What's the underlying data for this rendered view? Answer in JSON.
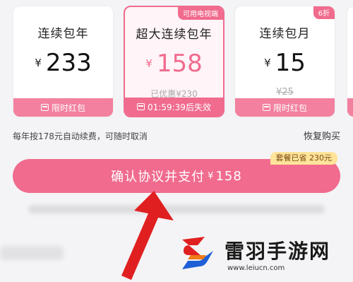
{
  "plans": [
    {
      "name": "连续包年",
      "currency": "¥",
      "price": "233",
      "note": "",
      "footer": "限时红包",
      "tag": ""
    },
    {
      "name": "超大连续包年",
      "currency": "¥",
      "price": "158",
      "note": "已优惠¥230",
      "footer": "01:59:39后失效",
      "tag": "可用电视端",
      "selected": true
    },
    {
      "name": "连续包月",
      "currency": "¥",
      "price": "15",
      "note": "¥25",
      "footer": "限时红包",
      "tag": "6折"
    }
  ],
  "auto_renew_text": "每年按178元自动续费，可随时取消",
  "restore_label": "恢复购买",
  "savings_badge": "套餐已省 230元",
  "pay_button": {
    "label": "确认协议并支付",
    "currency": "¥",
    "amount": "158"
  },
  "watermark": {
    "name": "雷羽手游网",
    "url": "www.leiucn.com"
  },
  "colors": {
    "accent": "#f06b8e",
    "accent_light": "#f2809e",
    "badge_bg": "#ffe49a",
    "arrow_red": "#e02020"
  }
}
